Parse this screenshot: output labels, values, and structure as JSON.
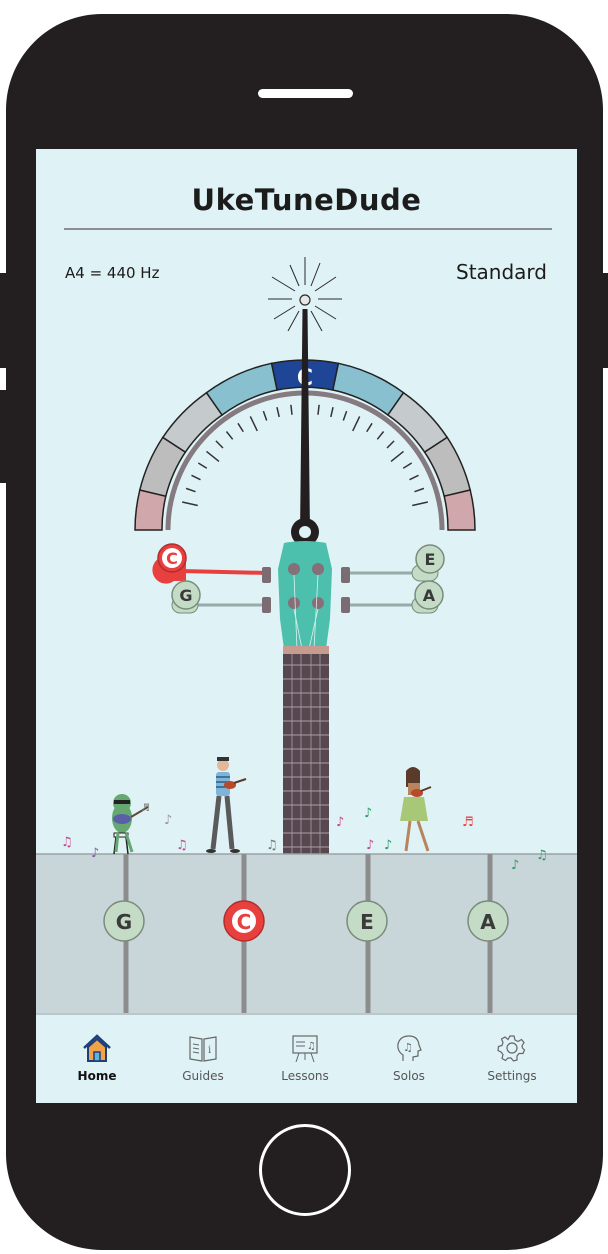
{
  "app": {
    "title": "UkeTuneDude"
  },
  "tuner": {
    "reference": "A4 = 440 Hz",
    "tuning_mode": "Standard",
    "target_note": "C"
  },
  "pegs": {
    "left_top": "C",
    "left_bottom": "G",
    "right_top": "E",
    "right_bottom": "A"
  },
  "strings": [
    {
      "note": "G",
      "active": false
    },
    {
      "note": "C",
      "active": true
    },
    {
      "note": "E",
      "active": false
    },
    {
      "note": "A",
      "active": false
    }
  ],
  "nav": {
    "items": [
      {
        "label": "Home",
        "icon": "home-icon",
        "active": true
      },
      {
        "label": "Guides",
        "icon": "book-icon",
        "active": false
      },
      {
        "label": "Lessons",
        "icon": "easel-icon",
        "active": false
      },
      {
        "label": "Solos",
        "icon": "head-music-icon",
        "active": false
      },
      {
        "label": "Settings",
        "icon": "gear-icon",
        "active": false
      }
    ]
  },
  "colors": {
    "screen_bg": "#dff2f6",
    "active_note": "#e8403f",
    "target_segment": "#1f4596",
    "headstock": "#4dbfad",
    "fretboard": "#57484f",
    "string_area": "#c8d6da"
  }
}
